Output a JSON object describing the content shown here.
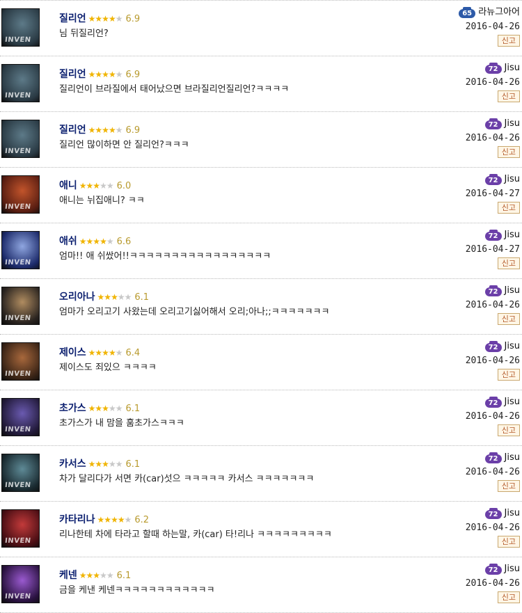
{
  "report_label": "신고",
  "avatar_watermark": "INVEN",
  "colors": {
    "badge_blue": "#2d5aa8",
    "badge_purple": "#6b3fa8",
    "champion_name": "#0a1e6e",
    "rating": "#b89a2e",
    "star_full": "#f0b400",
    "report_text": "#b35a2a"
  },
  "comments": [
    {
      "champion": "질리언",
      "stars": 3.5,
      "rating": "6.9",
      "text": "님 뒤질리언?",
      "level": "65",
      "badge_color": "blue",
      "author": "라뉴그아어",
      "date": "2016-04-26",
      "avatar_tone": [
        "#2a3a44",
        "#5d7a88"
      ]
    },
    {
      "champion": "질리언",
      "stars": 3.5,
      "rating": "6.9",
      "text": "질리언이 브라질에서 태어났으면 브라질리언질리언?ㅋㅋㅋㅋ",
      "level": "72",
      "badge_color": "purple",
      "author": "Jisu",
      "date": "2016-04-26",
      "avatar_tone": [
        "#2a3a44",
        "#5d7a88"
      ]
    },
    {
      "champion": "질리언",
      "stars": 3.5,
      "rating": "6.9",
      "text": "질리언 많이하면 안 질리언?ㅋㅋㅋ",
      "level": "72",
      "badge_color": "purple",
      "author": "Jisu",
      "date": "2016-04-26",
      "avatar_tone": [
        "#2a3a44",
        "#5d7a88"
      ]
    },
    {
      "champion": "애니",
      "stars": 3,
      "rating": "6.0",
      "text": "애니는 뉘집애니? ㅋㅋ",
      "level": "72",
      "badge_color": "purple",
      "author": "Jisu",
      "date": "2016-04-27",
      "avatar_tone": [
        "#5a1e12",
        "#c2542b"
      ]
    },
    {
      "champion": "애쉬",
      "stars": 3.5,
      "rating": "6.6",
      "text": "엄마!! 애 쉬쌌어!!ㅋㅋㅋㅋㅋㅋㅋㅋㅋㅋㅋㅋㅋㅋㅋㅋㅋ",
      "level": "72",
      "badge_color": "purple",
      "author": "Jisu",
      "date": "2016-04-27",
      "avatar_tone": [
        "#1c2a6a",
        "#8fa6e0"
      ]
    },
    {
      "champion": "오리아나",
      "stars": 3,
      "rating": "6.1",
      "text": "엄마가 오리고기 사왔는데 오리고기싫어해서 오리;아나;;ㅋㅋㅋㅋㅋㅋㅋ",
      "level": "72",
      "badge_color": "purple",
      "author": "Jisu",
      "date": "2016-04-26",
      "avatar_tone": [
        "#2a2420",
        "#b08c60"
      ]
    },
    {
      "champion": "제이스",
      "stars": 3.5,
      "rating": "6.4",
      "text": "제이스도 죄있으 ㅋㅋㅋㅋ",
      "level": "72",
      "badge_color": "purple",
      "author": "Jisu",
      "date": "2016-04-26",
      "avatar_tone": [
        "#3a2416",
        "#a8683c"
      ]
    },
    {
      "champion": "초가스",
      "stars": 3,
      "rating": "6.1",
      "text": "초가스가 내 맘을 훔초가스ㅋㅋㅋ",
      "level": "72",
      "badge_color": "purple",
      "author": "Jisu",
      "date": "2016-04-26",
      "avatar_tone": [
        "#221a3a",
        "#6a5ab0"
      ]
    },
    {
      "champion": "카서스",
      "stars": 3,
      "rating": "6.1",
      "text": "차가 달리다가 서면 카(car)섯으 ㅋㅋㅋㅋㅋ 카서스 ㅋㅋㅋㅋㅋㅋㅋ",
      "level": "72",
      "badge_color": "purple",
      "author": "Jisu",
      "date": "2016-04-26",
      "avatar_tone": [
        "#1a2a30",
        "#5e8a96"
      ]
    },
    {
      "champion": "카타리나",
      "stars": 3.5,
      "rating": "6.2",
      "text": "리나한테 차에 타라고 할때 하는말, 카(car) 타!리나 ㅋㅋㅋㅋㅋㅋㅋㅋㅋ",
      "level": "72",
      "badge_color": "purple",
      "author": "Jisu",
      "date": "2016-04-26",
      "avatar_tone": [
        "#4a0e14",
        "#c23a3a"
      ]
    },
    {
      "champion": "케넨",
      "stars": 3,
      "rating": "6.1",
      "text": "금을 케낸 케넨ㅋㅋㅋㅋㅋㅋㅋㅋㅋㅋㅋㅋ",
      "level": "72",
      "badge_color": "purple",
      "author": "Jisu",
      "date": "2016-04-26",
      "avatar_tone": [
        "#2a1240",
        "#9a5ad0"
      ]
    }
  ]
}
